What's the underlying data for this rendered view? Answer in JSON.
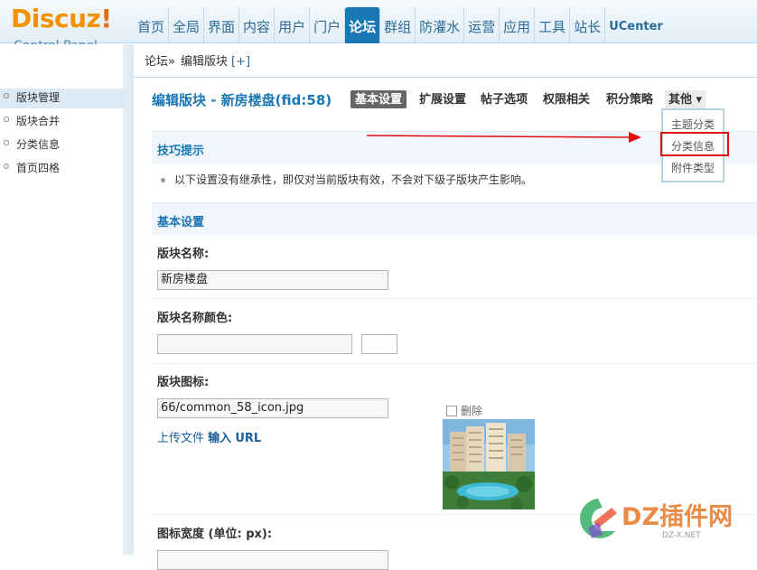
{
  "logo": {
    "brand": "Discuz",
    "bang": "!",
    "subtitle": "Control Panel"
  },
  "topnav": [
    {
      "label": "首页"
    },
    {
      "label": "全局"
    },
    {
      "label": "界面"
    },
    {
      "label": "内容"
    },
    {
      "label": "用户"
    },
    {
      "label": "门户"
    },
    {
      "label": "论坛",
      "active": true
    },
    {
      "label": "群组"
    },
    {
      "label": "防灌水"
    },
    {
      "label": "运营"
    },
    {
      "label": "应用"
    },
    {
      "label": "工具"
    },
    {
      "label": "站长"
    },
    {
      "label": "UCenter"
    }
  ],
  "breadcrumb": {
    "root": "论坛",
    "separator": "»",
    "current": "编辑版块",
    "add": "[+]"
  },
  "sidebar": {
    "items": [
      {
        "label": "版块管理",
        "active": true
      },
      {
        "label": "版块合并"
      },
      {
        "label": "分类信息"
      },
      {
        "label": "首页四格"
      }
    ]
  },
  "page": {
    "title": "编辑版块 - 新房楼盘(fid:58)",
    "tabs": [
      {
        "label": "基本设置",
        "active": true
      },
      {
        "label": "扩展设置"
      },
      {
        "label": "帖子选项"
      },
      {
        "label": "权限相关"
      },
      {
        "label": "积分策略"
      },
      {
        "label": "其他 ▾"
      }
    ]
  },
  "dropdown": {
    "items": [
      "主题分类",
      "分类信息",
      "附件类型"
    ],
    "highlighted": "分类信息"
  },
  "tips": {
    "title": "技巧提示",
    "text": "以下设置没有继承性，即仅对当前版块有效，不会对下级子版块产生影响。"
  },
  "basic": {
    "title": "基本设置",
    "name_label": "版块名称:",
    "name_value": "新房楼盘",
    "color_label": "版块名称颜色:",
    "color_value": "",
    "icon_label": "版块图标:",
    "icon_value": "66/common_58_icon.jpg",
    "delete_label": "删除",
    "upload": {
      "file": "上传文件",
      "input": "输入",
      "url": "URL"
    },
    "width_label": "图标宽度 (单位: px):"
  },
  "watermark": {
    "main": "DZ插件网",
    "sub": "DZ-X.NET"
  },
  "colors": {
    "accent": "#1877b4",
    "highlight_red": "#e10d0d",
    "logo_orange": "#f39200"
  }
}
